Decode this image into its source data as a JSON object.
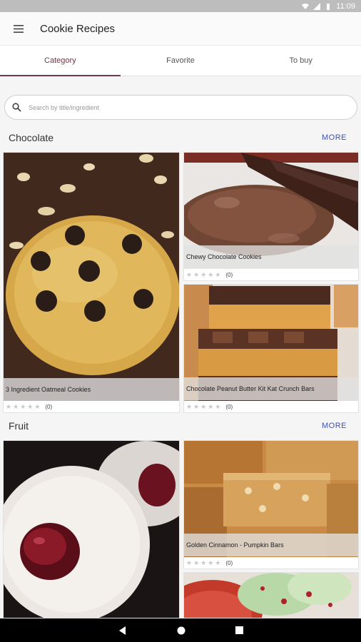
{
  "status_bar": {
    "time": "11:09"
  },
  "app_bar": {
    "title": "Cookie Recipes",
    "menu_icon": "menu-icon"
  },
  "tabs": [
    {
      "label": "Category",
      "active": true
    },
    {
      "label": "Favorite",
      "active": false
    },
    {
      "label": "To buy",
      "active": false
    }
  ],
  "search": {
    "placeholder": "Search by title/ingredient",
    "value": ""
  },
  "sections": [
    {
      "title": "Chocolate",
      "more_label": "MORE",
      "recipes": [
        {
          "title": "3 Ingredient Oatmeal Cookies",
          "rating_count": "(0)"
        },
        {
          "title": "Chewy Chocolate Cookies",
          "rating_count": "(0)"
        },
        {
          "title": "Chocolate Peanut Butter Kit Kat Crunch Bars",
          "rating_count": "(0)"
        }
      ]
    },
    {
      "title": "Fruit",
      "more_label": "MORE",
      "recipes": [
        {
          "title": "",
          "rating_count": ""
        },
        {
          "title": "Golden Cinnamon - Pumpkin Bars",
          "rating_count": "(0)"
        },
        {
          "title": "",
          "rating_count": ""
        }
      ]
    }
  ],
  "colors": {
    "accent": "#6b3a46",
    "link": "#3f51b5",
    "star": "#c8c8c8"
  }
}
